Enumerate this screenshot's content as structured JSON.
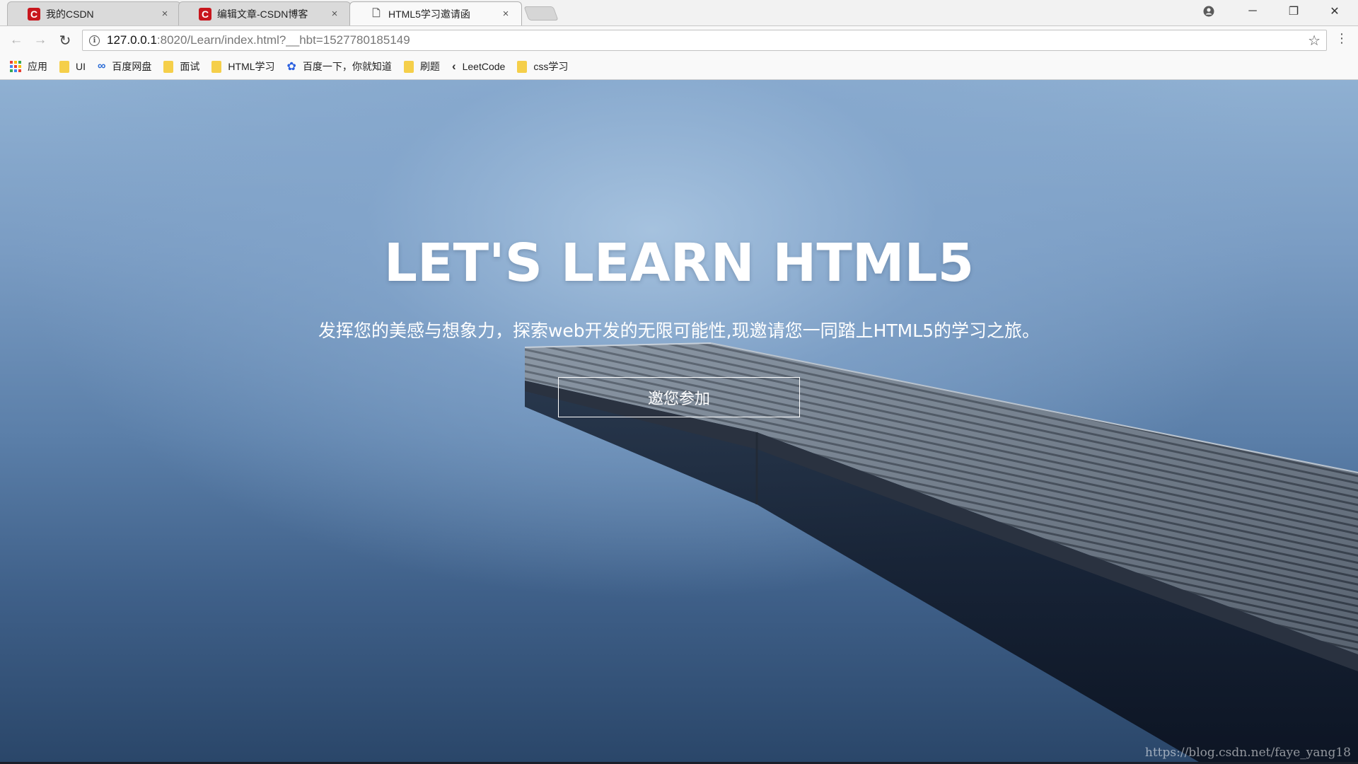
{
  "browser": {
    "tabs": [
      {
        "title": "我的CSDN",
        "favicon": "csdn-icon",
        "favicon_glyph": "C",
        "close": "×",
        "active": false
      },
      {
        "title": "编辑文章-CSDN博客",
        "favicon": "csdn-icon",
        "favicon_glyph": "C",
        "close": "×",
        "active": false
      },
      {
        "title": "HTML5学习邀请函",
        "favicon": "page-icon",
        "favicon_glyph": "🗋",
        "close": "×",
        "active": true
      }
    ],
    "window_controls": {
      "account": "account-icon",
      "minimize": "─",
      "restore": "❐",
      "close": "✕"
    },
    "nav": {
      "back": "←",
      "forward": "→",
      "reload": "↻"
    },
    "address": {
      "host": "127.0.0.1",
      "rest": ":8020/Learn/index.html?__hbt=1527780185149",
      "info": "i",
      "star": "☆",
      "menu": "⋮"
    },
    "bookmarks": [
      {
        "label": "应用",
        "icon": "apps-icon"
      },
      {
        "label": "UI",
        "icon": "folder-icon"
      },
      {
        "label": "百度网盘",
        "icon": "baidu-netdisk-icon"
      },
      {
        "label": "面试",
        "icon": "folder-icon"
      },
      {
        "label": "HTML学习",
        "icon": "folder-icon"
      },
      {
        "label": "百度一下，你就知道",
        "icon": "baidu-paw-icon"
      },
      {
        "label": "刷题",
        "icon": "folder-icon"
      },
      {
        "label": "LeetCode",
        "icon": "leetcode-icon"
      },
      {
        "label": "css学习",
        "icon": "folder-icon"
      }
    ]
  },
  "page": {
    "title": "LET'S LEARN HTML5",
    "subtitle": "发挥您的美感与想象力，探索web开发的无限可能性,现邀请您一同踏上HTML5的学习之旅。",
    "cta_label": "邀您参加",
    "watermark": "https://blog.csdn.net/faye_yang18"
  },
  "colors": {
    "csdn_red": "#c8161d",
    "folder_yellow": "#f5cf4a",
    "hero_text": "#ffffff"
  }
}
